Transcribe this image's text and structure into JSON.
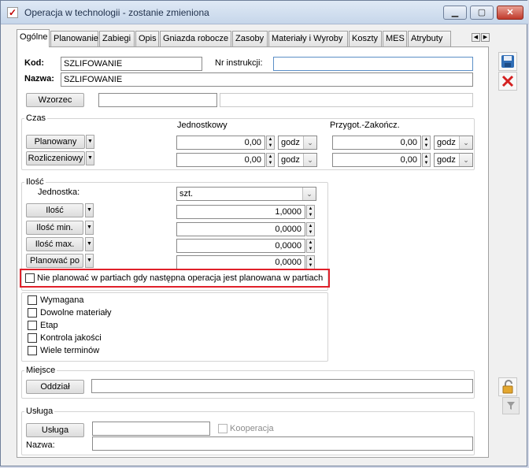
{
  "window": {
    "title": "Operacja w technologii - zostanie zmieniona",
    "minimize_icon": "minimize-icon",
    "maximize_icon": "maximize-icon",
    "close_icon": "close-icon"
  },
  "tabs": [
    {
      "label": "Ogólne",
      "active": true
    },
    {
      "label": "Planowanie"
    },
    {
      "label": "Zabiegi"
    },
    {
      "label": "Opis"
    },
    {
      "label": "Gniazda robocze"
    },
    {
      "label": "Zasoby"
    },
    {
      "label": "Materiały i Wyroby"
    },
    {
      "label": "Koszty"
    },
    {
      "label": "MES"
    },
    {
      "label": "Atrybuty"
    }
  ],
  "header": {
    "kod_label": "Kod:",
    "kod_value": "SZLIFOWANIE",
    "nr_instrukcji_label": "Nr instrukcji:",
    "nr_instrukcji_value": "",
    "nazwa_label": "Nazwa:",
    "nazwa_value": "SZLIFOWANIE",
    "wzorzec_button": "Wzorzec",
    "wzorzec_value": ""
  },
  "czas": {
    "title": "Czas",
    "col_jednostkowy": "Jednostkowy",
    "col_przygot": "Przygot.-Zakończ.",
    "rows": [
      {
        "button": "Planowany",
        "jedn_value": "0,00",
        "jedn_unit": "godz",
        "przyg_value": "0,00",
        "przyg_unit": "godz"
      },
      {
        "button": "Rozliczeniowy",
        "jedn_value": "0,00",
        "jedn_unit": "godz",
        "przyg_value": "0,00",
        "przyg_unit": "godz"
      }
    ]
  },
  "ilosc": {
    "title": "Ilość",
    "jednostka_label": "Jednostka:",
    "jednostka_value": "szt.",
    "rows": [
      {
        "button": "Ilość",
        "value": "1,0000"
      },
      {
        "button": "Ilość min.",
        "value": "0,0000"
      },
      {
        "button": "Ilość max.",
        "value": "0,0000"
      },
      {
        "button": "Planować po",
        "value": "0,0000"
      }
    ],
    "partie_checkbox": "Nie planować w partiach gdy następna operacja jest planowana w partiach"
  },
  "flags": [
    {
      "label": "Wymagana",
      "checked": false
    },
    {
      "label": "Dowolne materiały",
      "checked": false
    },
    {
      "label": "Etap",
      "checked": false
    },
    {
      "label": "Kontrola jakości",
      "checked": false
    },
    {
      "label": "Wiele terminów",
      "checked": false
    }
  ],
  "miejsce": {
    "title": "Miejsce",
    "oddzial_button": "Oddział",
    "oddzial_value": ""
  },
  "usluga": {
    "title": "Usługa",
    "usluga_button": "Usługa",
    "usluga_value": "",
    "kooperacja_label": "Kooperacja",
    "nazwa_label": "Nazwa:",
    "nazwa_value": ""
  },
  "side": {
    "save_icon": "save-icon",
    "cancel_icon": "cancel-icon",
    "lock_icon": "lock-icon",
    "filter_icon": "filter-icon"
  },
  "colors": {
    "highlight": "#e0202a",
    "cancel": "#d42020",
    "save": "#2f6db5"
  }
}
